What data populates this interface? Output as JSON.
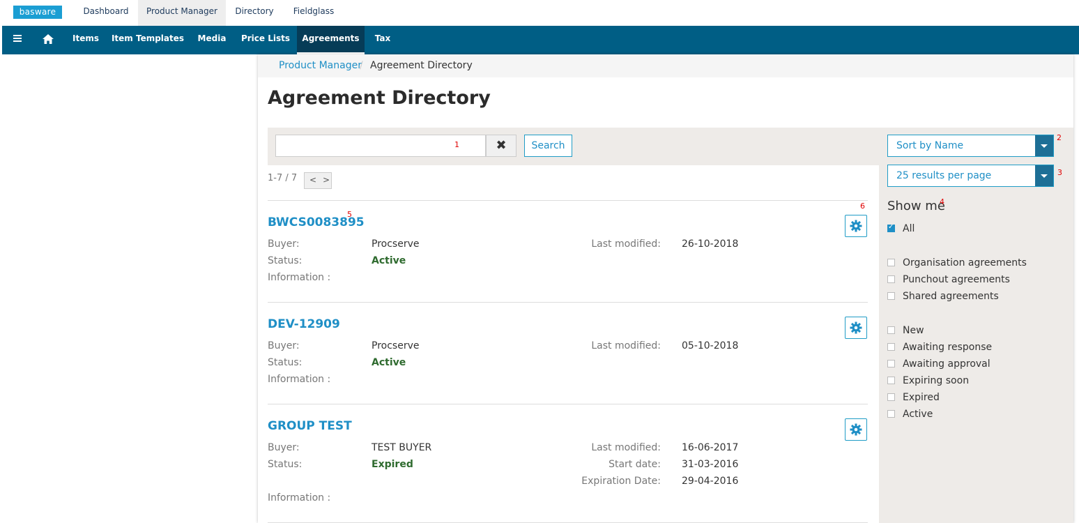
{
  "top_nav": {
    "logo": "basware",
    "tabs": [
      "Dashboard",
      "Product Manager",
      "Directory",
      "Fieldglass"
    ]
  },
  "main_nav": {
    "items": [
      "Items",
      "Item Templates",
      "Media",
      "Price Lists",
      "Agreements",
      "Tax"
    ]
  },
  "breadcrumb": {
    "link": "Product Manager",
    "separator": "/",
    "current": "Agreement Directory"
  },
  "page_title": "Agreement Directory",
  "search": {
    "value": "",
    "placeholder": "",
    "button_label": "Search"
  },
  "pager": {
    "range": "1-7 / 7",
    "prev": "<",
    "next": ">"
  },
  "markers": [
    "1",
    "2",
    "3",
    "4",
    "5",
    "6"
  ],
  "labels": {
    "buyer": "Buyer:",
    "status": "Status:",
    "information": "Information :",
    "last_modified": "Last modified:",
    "start_date": "Start date:",
    "expiration_date": "Expiration Date:"
  },
  "agreements": [
    {
      "title": "BWCS0083895",
      "buyer": "Procserve",
      "status": "Active",
      "last_modified": "26-10-2018"
    },
    {
      "title": "DEV-12909",
      "buyer": "Procserve",
      "status": "Active",
      "last_modified": "05-10-2018"
    },
    {
      "title": "GROUP TEST",
      "buyer": "TEST BUYER",
      "status": "Expired",
      "last_modified": "16-06-2017",
      "start_date": "31-03-2016",
      "expiration_date": "29-04-2016"
    }
  ],
  "sort": {
    "selected": "Sort by Name"
  },
  "per_page": {
    "selected": "25 results per page"
  },
  "show_me": {
    "title": "Show me",
    "all": {
      "label": "All",
      "checked": true
    },
    "types": [
      "Organisation agreements",
      "Punchout agreements",
      "Shared agreements"
    ],
    "statuses": [
      "New",
      "Awaiting response",
      "Awaiting approval",
      "Expiring soon",
      "Expired",
      "Active"
    ]
  },
  "colors": {
    "nav_bg": "#005e85",
    "nav_active": "#063c57",
    "link": "#1f8fc6",
    "status_green": "#2f6b2f",
    "marker_red": "#e00000",
    "panel_bg": "#eeebe8"
  }
}
